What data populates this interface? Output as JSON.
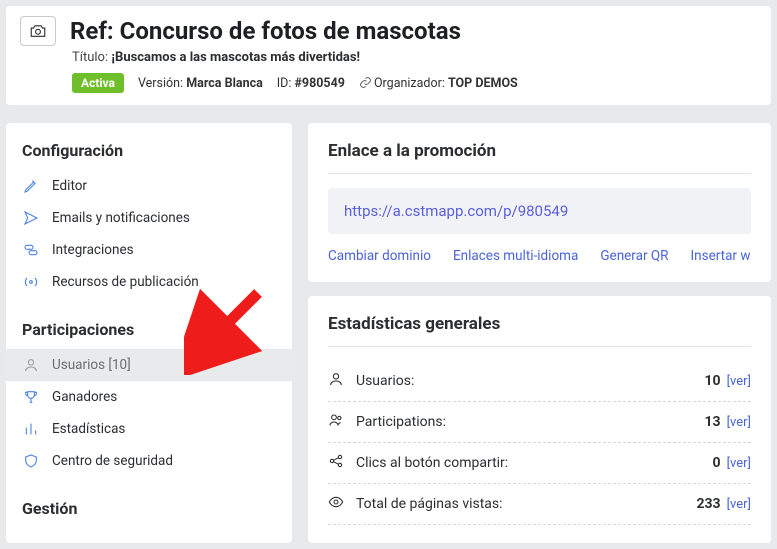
{
  "header": {
    "ref_label": "Ref: Concurso de fotos de mascotas",
    "titulo_label": "Título: ",
    "titulo_value": "¡Buscamos a las mascotas más divertidas!",
    "status_badge": "Activa",
    "version_label": "Versión: ",
    "version_value": "Marca Blanca",
    "id_label": "ID: ",
    "id_value": "#980549",
    "org_label": "Organizador: ",
    "org_value": "TOP DEMOS"
  },
  "sidebar": {
    "group_config": "Configuración",
    "items_config": {
      "editor": "Editor",
      "emails": "Emails y notificaciones",
      "integraciones": "Integraciones",
      "recursos": "Recursos de publicación"
    },
    "group_part": "Participaciones",
    "items_part": {
      "usuarios": "Usuarios [10]",
      "ganadores": "Ganadores",
      "estadisticas": "Estadísticas",
      "seguridad": "Centro de seguridad"
    },
    "group_gestion": "Gestión"
  },
  "promo_link": {
    "title": "Enlace a la promoción",
    "url": "https://a.cstmapp.com/p/980549",
    "actions": {
      "cambiar": "Cambiar dominio",
      "multi": "Enlaces multi-idioma",
      "qr": "Generar QR",
      "insertar": "Insertar widget"
    }
  },
  "stats": {
    "title": "Estadísticas generales",
    "rows": [
      {
        "label": "Usuarios:",
        "value": "10",
        "ver": "[ver]"
      },
      {
        "label": "Participations:",
        "value": "13",
        "ver": "[ver]"
      },
      {
        "label": "Clics al botón compartir:",
        "value": "0",
        "ver": "[ver]"
      },
      {
        "label": "Total de páginas vistas:",
        "value": "233",
        "ver": "[ver]"
      }
    ]
  }
}
